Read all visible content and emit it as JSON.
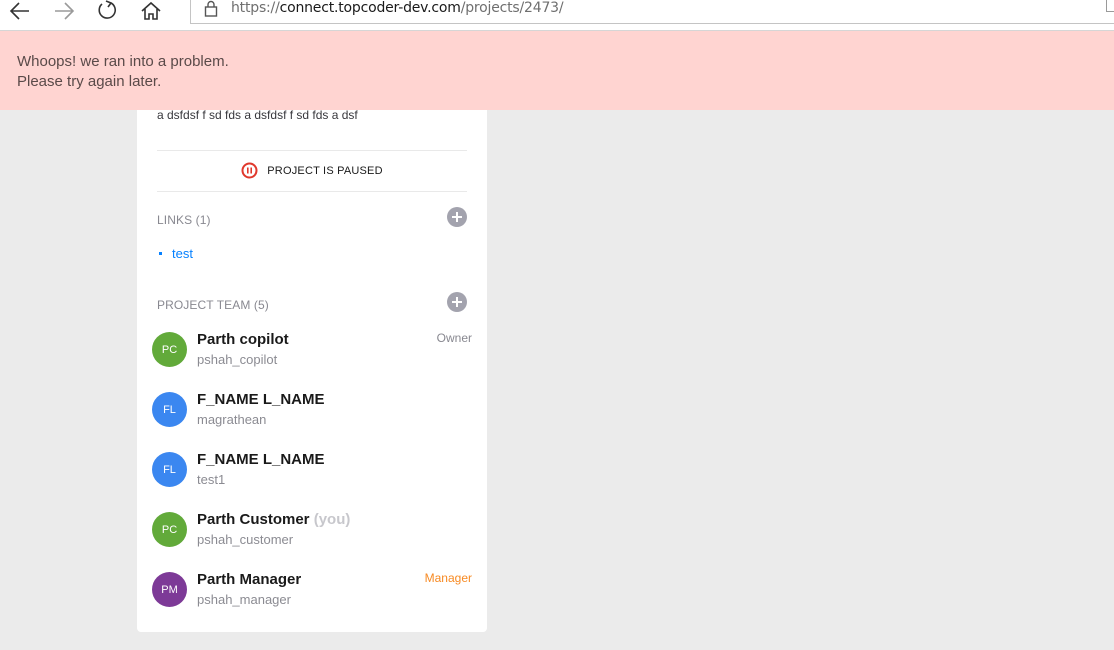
{
  "browser": {
    "url_scheme": "https://",
    "url_host": "connect.topcoder-dev.com",
    "url_path": "/projects/2473/"
  },
  "error_banner": {
    "line1": "Whoops! we ran into a problem.",
    "line2": "Please try again later."
  },
  "project": {
    "description": "a dsfdsf f sd fds a dsfdsf f sd fds a dsf",
    "status_label": "PROJECT IS PAUSED",
    "links_title": "LINKS (1)",
    "links": [
      {
        "label": "test"
      }
    ],
    "team_title": "PROJECT TEAM (5)",
    "team": [
      {
        "initials": "PC",
        "name": "Parth copilot",
        "you_label": "",
        "handle": "pshah_copilot",
        "role": "Owner",
        "avatar_color": "#62aa3a"
      },
      {
        "initials": "FL",
        "name": "F_NAME L_NAME",
        "you_label": "",
        "handle": "magrathean",
        "role": "",
        "avatar_color": "#3b87f0"
      },
      {
        "initials": "FL",
        "name": "F_NAME L_NAME",
        "you_label": "",
        "handle": "test1",
        "role": "",
        "avatar_color": "#3b87f0"
      },
      {
        "initials": "PC",
        "name": "Parth Customer",
        "you_label": "(you)",
        "handle": "pshah_customer",
        "role": "",
        "avatar_color": "#62aa3a"
      },
      {
        "initials": "PM",
        "name": "Parth Manager",
        "you_label": "",
        "handle": "pshah_manager",
        "role": "Manager",
        "avatar_color": "#7d3a97"
      }
    ]
  },
  "colors": {
    "error_bg": "#ffd4d1",
    "link": "#0681ff",
    "paused_icon": "#e0382c",
    "manager_role": "#f78a23"
  }
}
